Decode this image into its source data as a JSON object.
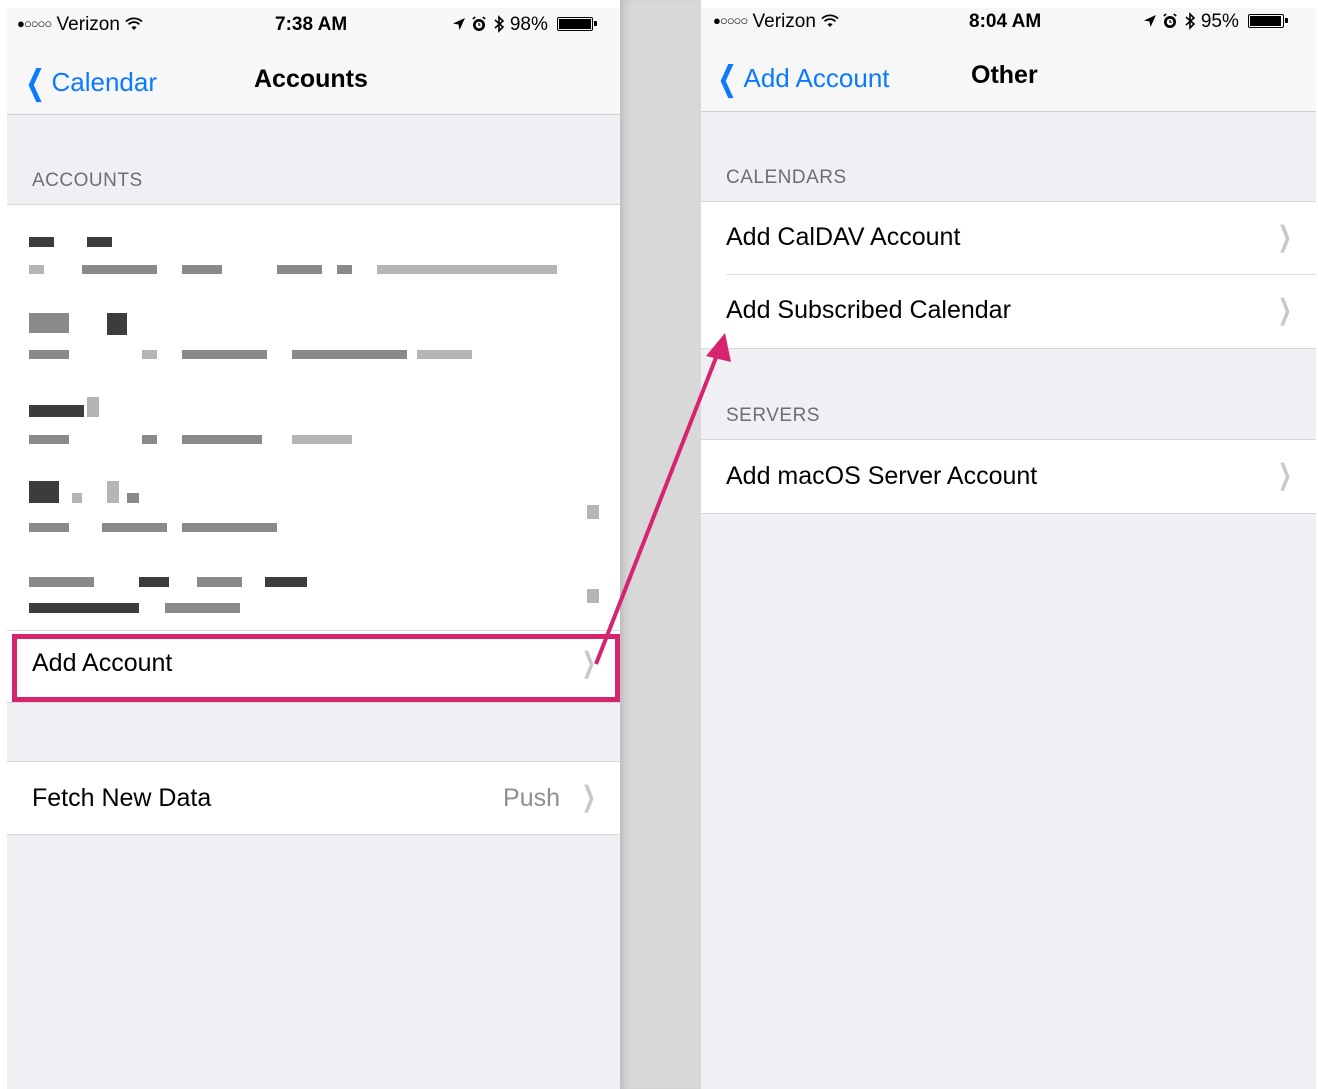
{
  "left_screen": {
    "status_bar": {
      "carrier_signal": "●○○○○",
      "carrier": "Verizon",
      "wifi_icon": "wifi-icon",
      "time": "7:38 AM",
      "battery_percent": "98%",
      "battery_level": 0.98
    },
    "nav": {
      "back_label": "Calendar",
      "title": "Accounts"
    },
    "accounts_header": "ACCOUNTS",
    "add_account_label": "Add Account",
    "fetch_new_data": {
      "label": "Fetch New Data",
      "value": "Push"
    }
  },
  "right_screen": {
    "status_bar": {
      "carrier_signal": "●○○○○",
      "carrier": "Verizon",
      "time": "8:04 AM",
      "battery_percent": "95%",
      "battery_level": 0.95
    },
    "nav": {
      "back_label": "Add Account",
      "title": "Other"
    },
    "calendars_header": "CALENDARS",
    "calendars_items": [
      {
        "label": "Add CalDAV Account"
      },
      {
        "label": "Add Subscribed Calendar"
      }
    ],
    "servers_header": "SERVERS",
    "servers_items": [
      {
        "label": "Add macOS Server Account"
      }
    ]
  },
  "annotation": {
    "highlight_color": "#d6246e",
    "arrow_color": "#d6246e"
  },
  "colors": {
    "ios_blue": "#0a7aff",
    "group_bg": "#efeff4",
    "chevron": "#c7c7cc"
  }
}
